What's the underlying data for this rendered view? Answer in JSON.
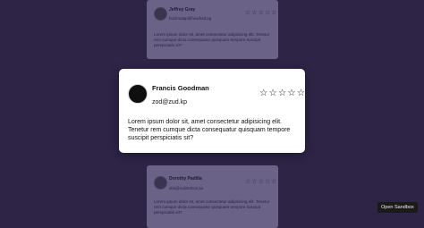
{
  "cards": [
    {
      "name": "Jeffrey Gray",
      "email": "hozimutap@huwfutd.pg",
      "body": "Lorem ipsum dolor sit, amet consectetur adipisicing elit. Tenetur rem cumque dicta consequatur quisquam tempore suscipit perspiciatis sit?",
      "rating": "☆☆☆☆☆"
    },
    {
      "name": "Francis Goodman",
      "email": "zod@zud.kp",
      "body": "Lorem ipsum dolor sit, amet consectetur adipisicing elit. Tenetur rem cumque dicta consequatur quisquam tempore suscipit perspiciatis sit?",
      "rating": "☆☆☆☆☆"
    },
    {
      "name": "Dorothy Padilla",
      "email": "dris@vulimdzos.za",
      "body": "Lorem ipsum dolor sit, amet consectetur adipisicing elit. Tenetur rem cumque dicta consequatur quisquam tempore suscipit perspiciatis sit?",
      "rating": "☆☆☆☆☆"
    }
  ],
  "open_sandbox_label": "Open Sandbox",
  "colors": {
    "background": "#2d2446",
    "dim_card": "#6b6287",
    "main_card": "#ffffff"
  }
}
